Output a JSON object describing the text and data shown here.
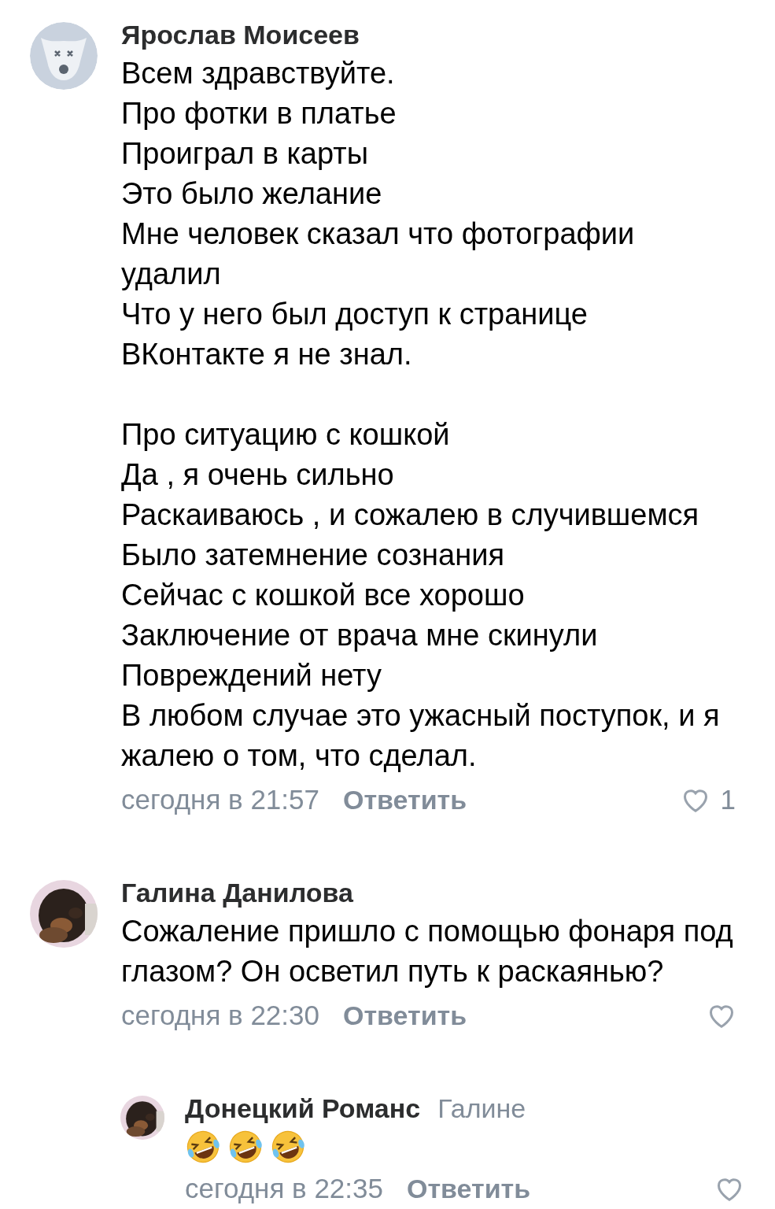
{
  "comments": [
    {
      "author": "Ярослав Моисеев",
      "avatar": {
        "kind": "placeholder"
      },
      "text": "Всем здравствуйте.\nПро фотки в платье\nПроиграл в карты\nЭто было желание\nМне человек сказал что фотографии удалил\nЧто у него был доступ к странице\nВКонтакте я не знал.\n\nПро ситуацию с кошкой\nДа , я очень сильно\nРаскаиваюсь , и сожалею в случившемся\nБыло затемнение сознания\nСейчас с кошкой все хорошо\nЗаключение от врача мне скинули\nПовреждений нету\nВ любом случае это ужасный поступок, и я жалею о том, что сделал.",
      "time": "сегодня в 21:57",
      "reply": "Ответить",
      "likes": "1"
    },
    {
      "author": "Галина Данилова",
      "avatar": {
        "kind": "picture"
      },
      "text": "Сожаление пришло с помощью фонаря под глазом? Он осветил путь к раскаянью?",
      "time": "сегодня в 22:30",
      "reply": "Ответить",
      "replies": [
        {
          "author": "Донецкий Романс",
          "addressee": "Галине",
          "avatar": {
            "kind": "picture"
          },
          "emojis": [
            {
              "kind": "laughing"
            },
            {
              "kind": "laughing"
            },
            {
              "kind": "laughing"
            }
          ],
          "time": "сегодня в 22:35",
          "reply": "Ответить"
        }
      ]
    }
  ]
}
